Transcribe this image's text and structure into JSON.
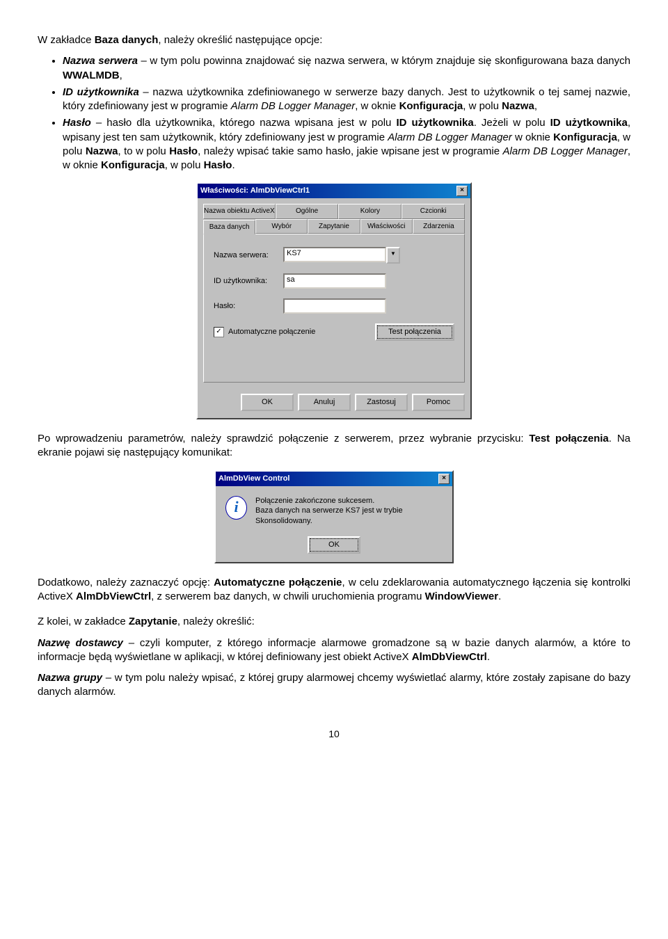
{
  "para1_pre": "W zakładce ",
  "para1_b1": "Baza danych",
  "para1_post": ", należy określić następujące opcje:",
  "bullets": [
    {
      "lead_b_i": "Nazwa serwera",
      "rest": " – w tym polu powinna znajdować się nazwa serwera, w którym znajduje się skonfigurowana baza danych ",
      "b2": "WWALMDB",
      "tail": ","
    },
    {
      "lead_b_i": "ID użytkownika",
      "rest": " – nazwa użytkownika zdefiniowanego w serwerze bazy danych. Jest to użytkownik o tej samej nazwie, który zdefiniowany jest w programie ",
      "i2": "Alarm DB Logger Manager",
      "mid": ", w oknie ",
      "b2": "Konfiguracja",
      "mid2": ", w polu ",
      "b3": "Nazwa",
      "tail": ","
    },
    {
      "lead_b_i": "Hasło",
      "rest": " – hasło dla użytkownika, którego nazwa wpisana jest w polu ",
      "b2": "ID użytkownika",
      "mid": ". Jeżeli w polu ",
      "b3": "ID użytkownika",
      "mid2": ", wpisany jest ten sam użytkownik, który zdefiniowany jest w programie ",
      "i2": "Alarm DB Logger Manager",
      "mid3": " w oknie ",
      "b4": "Konfiguracja",
      "mid4": ", w polu ",
      "b5": "Nazwa",
      "mid5": ", to w polu ",
      "b6": "Hasło",
      "mid6": ", należy wpisać takie samo hasło, jakie wpisane jest w programie ",
      "i3": "Alarm DB Logger Manager",
      "mid7": ", w oknie ",
      "b7": "Konfiguracja",
      "mid8": ", w polu ",
      "b8": "Hasło",
      "tail": "."
    }
  ],
  "dialog1": {
    "title": "Właściwości: AlmDbViewCtrl1",
    "tabs_row1": [
      "Nazwa obiektu ActiveX",
      "Ogólne",
      "Kolory",
      "Czcionki"
    ],
    "tabs_row2": [
      "Baza danych",
      "Wybór",
      "Zapytanie",
      "Właściwości",
      "Zdarzenia"
    ],
    "lbl_server": "Nazwa serwera:",
    "val_server": "KS7",
    "lbl_user": "ID użytkownika:",
    "val_user": "sa",
    "lbl_pass": "Hasło:",
    "val_pass": "",
    "chk_label": "Automatyczne połączenie",
    "btn_test": "Test połączenia",
    "btn_ok": "OK",
    "btn_anuluj": "Anuluj",
    "btn_zastosuj": "Zastosuj",
    "btn_pomoc": "Pomoc"
  },
  "para2_pre": "Po wprowadzeniu parametrów, należy sprawdzić połączenie z serwerem, przez wybranie przycisku: ",
  "para2_b": "Test połączenia",
  "para2_post": ". Na ekranie pojawi się następujący komunikat:",
  "msgbox": {
    "title": "AlmDbView Control",
    "line1": "Połączenie zakończone sukcesem.",
    "line2": "Baza danych na serwerze KS7 jest w trybie Skonsolidowany.",
    "ok": "OK"
  },
  "para3_pre": " Dodatkowo, należy zaznaczyć opcję: ",
  "para3_b1": "Automatyczne połączenie",
  "para3_mid1": ", w celu zdeklarowania automatycznego łączenia się kontrolki ActiveX ",
  "para3_b2": "AlmDbViewCtrl",
  "para3_mid2": ", z serwerem baz danych, w chwili uruchomienia programu ",
  "para3_b3": "WindowViewer",
  "para3_tail": ".",
  "para4_pre": "Z kolei, w zakładce ",
  "para4_b": "Zapytanie",
  "para4_post": ", należy określić:",
  "para5_b": "Nazwę dostawcy",
  "para5_mid": " – czyli komputer, z którego informacje alarmowe gromadzone są w bazie danych alarmów, a które to informacje będą wyświetlane w aplikacji, w której definiowany jest obiekt ActiveX ",
  "para5_b2": "AlmDbViewCtrl",
  "para5_tail": ".",
  "para6_b": "Nazwa grupy",
  "para6_rest": " – w tym polu należy wpisać, z której grupy alarmowej chcemy wyświetlać alarmy, które zostały zapisane do bazy danych alarmów.",
  "page_no": "10"
}
